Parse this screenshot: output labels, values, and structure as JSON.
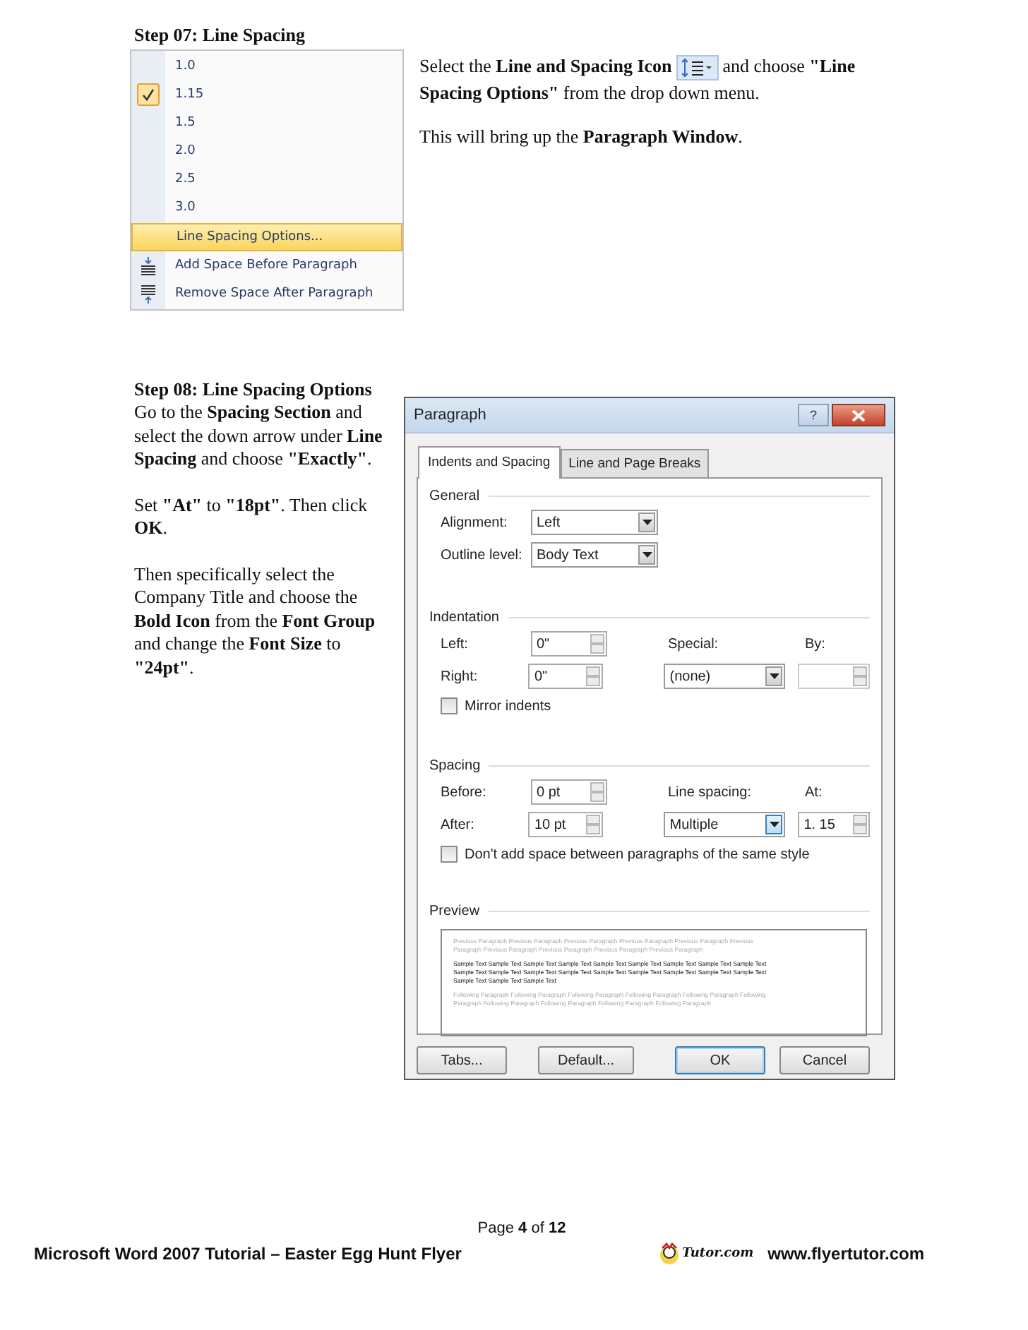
{
  "step07": {
    "title": "Step 07: Line Spacing",
    "menu": [
      {
        "label": "1.0",
        "kind": "value",
        "checked": false,
        "selected": false
      },
      {
        "label": "1.15",
        "kind": "value",
        "checked": true,
        "selected": false
      },
      {
        "label": "1.5",
        "kind": "value",
        "checked": false,
        "selected": false
      },
      {
        "label": "2.0",
        "kind": "value",
        "checked": false,
        "selected": false
      },
      {
        "label": "2.5",
        "kind": "value",
        "checked": false,
        "selected": false
      },
      {
        "label": "3.0",
        "kind": "value",
        "checked": false,
        "selected": false
      },
      {
        "label": "Line Spacing Options...",
        "kind": "options",
        "selected": true
      },
      {
        "label": "Add Space Before Paragraph",
        "kind": "space_before",
        "selected": false
      },
      {
        "label": "Remove Space After Paragraph",
        "kind": "space_after",
        "selected": false
      }
    ],
    "instructions": [
      {
        "before": "Select the **Line and Spacing Icon**",
        "after": "and choose **\"Line Spacing Options\"** from the drop down menu."
      },
      {
        "before": "This will bring up the **Paragraph Window**."
      }
    ]
  },
  "step08": {
    "title": "Step 08: Line Spacing Options",
    "paragraphs": [
      "Go to the **Spacing Section** and select the down arrow under **Line Spacing** and choose **\"Exactly\"**.",
      "Set **\"At\"** to **\"18pt\"**. Then click **OK**.",
      "Then specifically select the Company Title and choose the **Bold Icon** from the **Font Group** and change the **Font Size** to **\"24pt\"**."
    ]
  },
  "dialog": {
    "title": "Paragraph",
    "help": "?",
    "tabs": [
      {
        "label": "Indents and Spacing",
        "selected": true
      },
      {
        "label": "Line and Page Breaks",
        "selected": false
      }
    ],
    "general": {
      "heading": "General",
      "alignment": {
        "label": "Alignment:",
        "value": "Left"
      },
      "outline": {
        "label": "Outline level:",
        "value": "Body Text"
      }
    },
    "indentation": {
      "heading": "Indentation",
      "left": {
        "label": "Left:",
        "value": "0\""
      },
      "right": {
        "label": "Right:",
        "value": "0\""
      },
      "special": {
        "label": "Special:",
        "value": "(none)"
      },
      "by": {
        "label": "By:"
      },
      "mirror": {
        "label": "Mirror indents",
        "checked": false
      }
    },
    "spacing": {
      "heading": "Spacing",
      "before": {
        "label": "Before:",
        "value": "0 pt"
      },
      "after": {
        "label": "After:",
        "value": "10 pt"
      },
      "line_spacing": {
        "label": "Line spacing:",
        "value": "Multiple"
      },
      "at": {
        "label": "At:",
        "value": "1. 15"
      },
      "dont_add": {
        "label": "Don't add space between paragraphs of the same style",
        "checked": false
      }
    },
    "preview": {
      "heading": "Preview",
      "blocks": [
        {
          "kind": "previous",
          "lines": [
            "Previous Paragraph Previous Paragraph Previous Paragraph Previous Paragraph Previous Paragraph Previous",
            "Paragraph Previous Paragraph Previous Paragraph Previous Paragraph Previous Paragraph"
          ]
        },
        {
          "kind": "sample",
          "lines": [
            "Sample Text Sample Text Sample Text Sample Text Sample Text Sample Text Sample Text Sample Text Sample Text",
            "Sample Text Sample Text Sample Text Sample Text Sample Text Sample Text Sample Text Sample Text Sample Text",
            "Sample Text Sample Text Sample Text"
          ]
        },
        {
          "kind": "following",
          "lines": [
            "Following Paragraph Following Paragraph Following Paragraph Following Paragraph Following Paragraph Following",
            "Paragraph Following Paragraph Following Paragraph Following Paragraph Following Paragraph"
          ]
        }
      ]
    },
    "buttons": [
      {
        "label": "Tabs...",
        "default": false
      },
      {
        "label": "Default...",
        "default": false
      },
      {
        "label": "OK",
        "default": true
      },
      {
        "label": "Cancel",
        "default": false
      }
    ]
  },
  "footer": {
    "page": "Page **4** of **12**",
    "title": "Microsoft Word 2007 Tutorial – Easter Egg Hunt Flyer",
    "logo_text": "Tutor.com",
    "url": "www.flyertutor.com"
  }
}
